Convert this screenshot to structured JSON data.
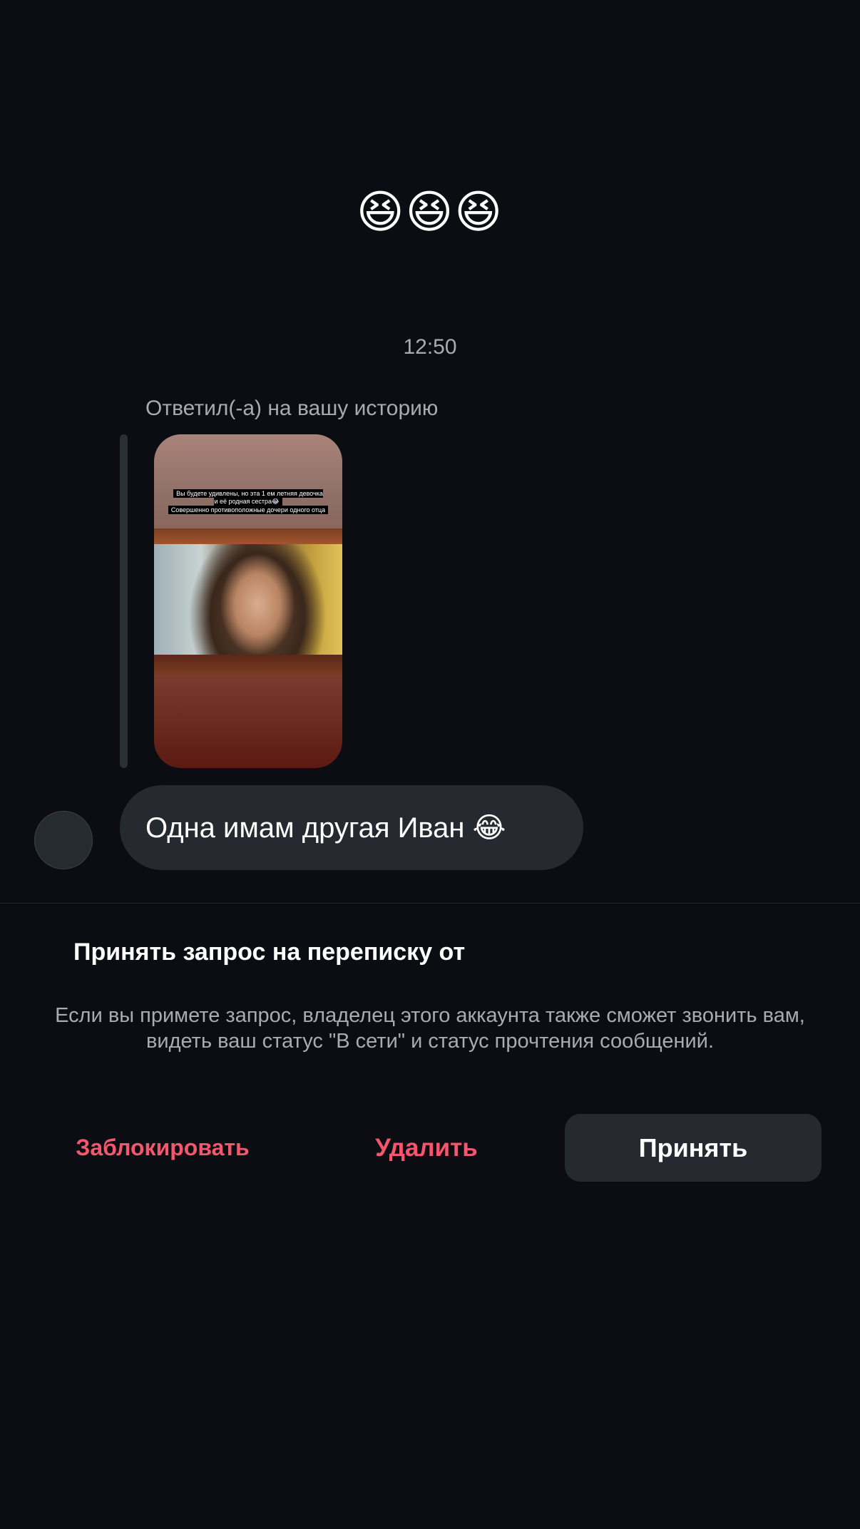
{
  "chat": {
    "emoji_message": "😆😆😆",
    "timestamp": "12:50",
    "reply_label": "Ответил(-а) на вашу историю",
    "story": {
      "line1": "Вы будете удивлены, но эта 1 ем летняя девочка и  её родная сестра😂",
      "line2": "Совершенно противоположные дочери одного отца"
    },
    "message": "Одна имам другая Иван 😂"
  },
  "request": {
    "title": "Принять запрос на переписку от",
    "description": "Если вы примете запрос, владелец этого аккаунта также сможет звонить вам, видеть ваш статус \"В сети\" и статус прочтения сообщений.",
    "block_label": "Заблокировать",
    "delete_label": "Удалить",
    "accept_label": "Принять"
  },
  "colors": {
    "background": "#0b0d12",
    "bubble": "#26292f",
    "danger": "#f4576d",
    "secondary_text": "#a8abb3"
  }
}
